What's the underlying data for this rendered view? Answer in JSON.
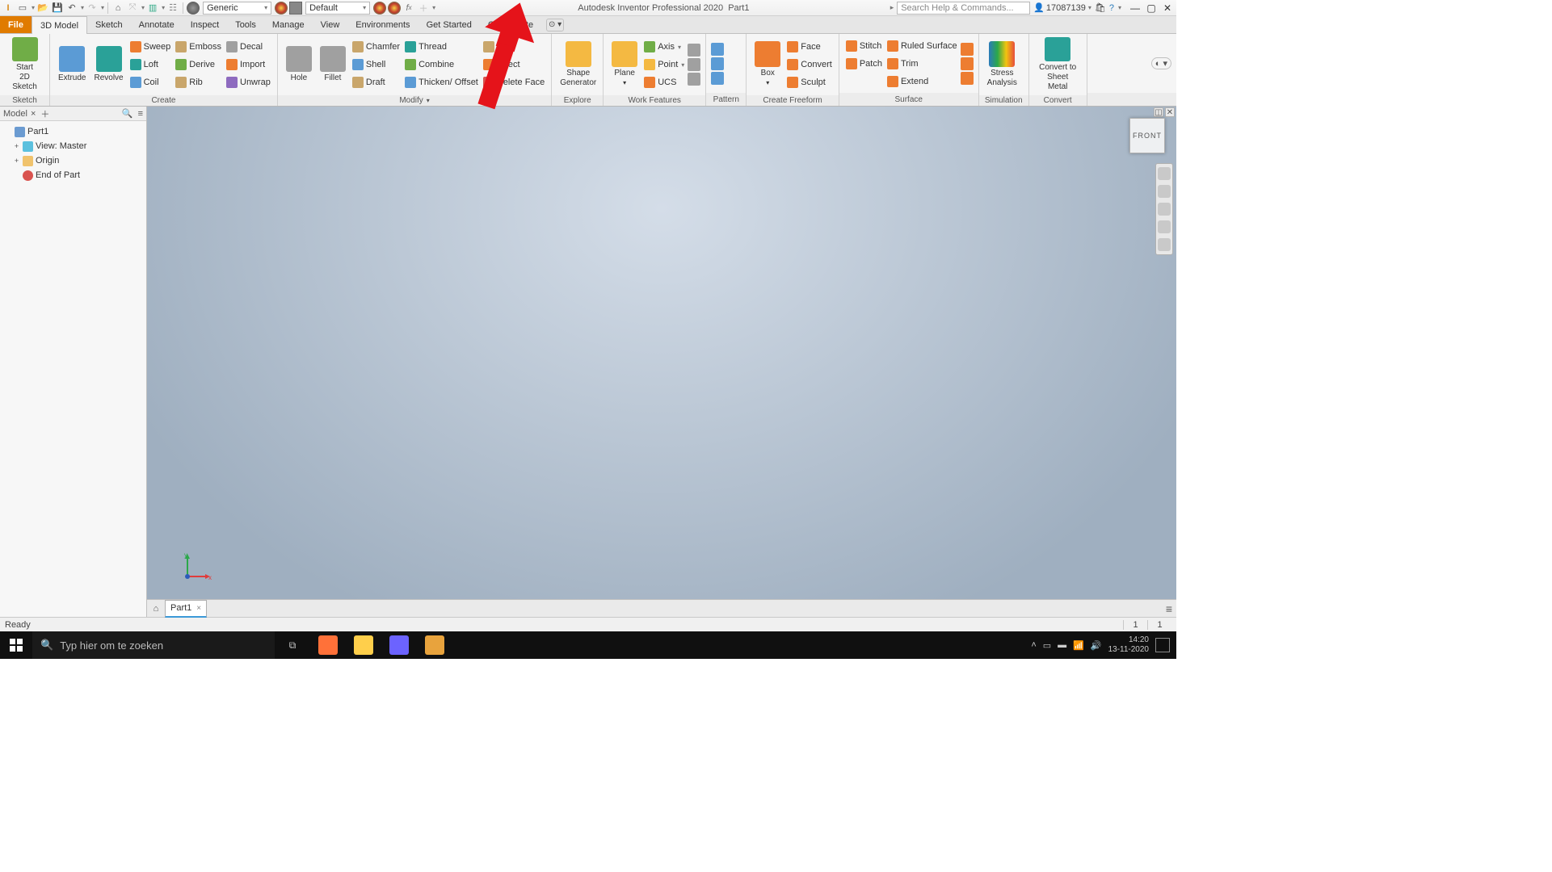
{
  "title": {
    "app": "Autodesk Inventor Professional 2020",
    "doc": "Part1"
  },
  "qat": {
    "material": "Generic",
    "appearance": "Default"
  },
  "search": {
    "placeholder": "Search Help & Commands..."
  },
  "user": {
    "id": "17087139"
  },
  "tabs": [
    "File",
    "3D Model",
    "Sketch",
    "Annotate",
    "Inspect",
    "Tools",
    "Manage",
    "View",
    "Environments",
    "Get Started",
    "Collaborate"
  ],
  "ribbon": {
    "sketch": {
      "btn": "Start\n2D Sketch",
      "title": "Sketch"
    },
    "create": {
      "extrude": "Extrude",
      "revolve": "Revolve",
      "r1": [
        "Sweep",
        "Emboss",
        "Decal"
      ],
      "r2": [
        "Loft",
        "Derive",
        "Import"
      ],
      "r3": [
        "Coil",
        "Rib",
        "Unwrap"
      ],
      "title": "Create"
    },
    "modify": {
      "hole": "Hole",
      "fillet": "Fillet",
      "r1": [
        "Chamfer",
        "Thread",
        "Split"
      ],
      "r2": [
        "Shell",
        "Combine",
        "Direct"
      ],
      "r3": [
        "Draft",
        "Thicken/ Offset",
        "Delete Face"
      ],
      "title": "Modify"
    },
    "explore": {
      "btn": "Shape\nGenerator",
      "title": "Explore"
    },
    "work": {
      "plane": "Plane",
      "axis": "Axis",
      "point": "Point",
      "ucs": "UCS",
      "title": "Work Features"
    },
    "pattern": {
      "title": "Pattern"
    },
    "freeform": {
      "box": "Box",
      "r1": [
        "Face",
        "Convert",
        "Sculpt"
      ],
      "title": "Create Freeform"
    },
    "surface": {
      "r1": [
        "Stitch",
        "Ruled Surface"
      ],
      "r2": [
        "Patch",
        "Trim"
      ],
      "r3": [
        "Extend"
      ],
      "title": "Surface"
    },
    "sim": {
      "btn": "Stress\nAnalysis",
      "title": "Simulation"
    },
    "convert": {
      "btn": "Convert to\nSheet Metal",
      "title": "Convert"
    }
  },
  "browser": {
    "tab": "Model",
    "items": [
      {
        "label": "Part1",
        "icon": "cube",
        "expander": ""
      },
      {
        "label": "View: Master",
        "icon": "view",
        "expander": "+",
        "indent": true
      },
      {
        "label": "Origin",
        "icon": "folder",
        "expander": "+",
        "indent": true
      },
      {
        "label": "End of Part",
        "icon": "err",
        "expander": "",
        "indent": true
      }
    ]
  },
  "viewcube": "FRONT",
  "doc_tab": "Part1",
  "status": {
    "msg": "Ready",
    "n1": "1",
    "n2": "1"
  },
  "taskbar": {
    "search": "Typ hier om te zoeken",
    "time": "14:20",
    "date": "13-11-2020"
  },
  "triad": {
    "x": "x",
    "y": "y"
  }
}
